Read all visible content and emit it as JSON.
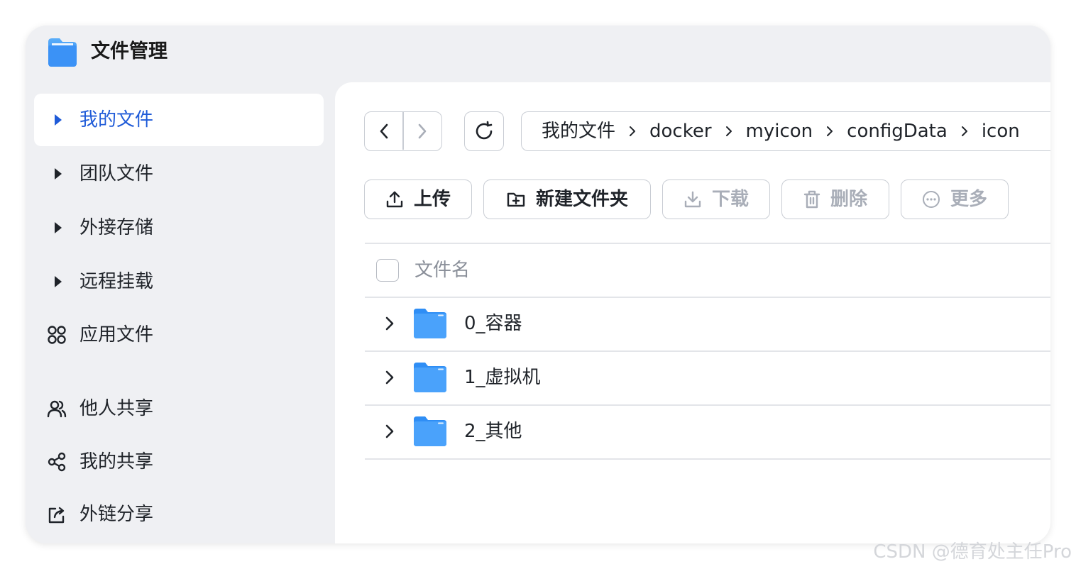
{
  "app": {
    "title": "文件管理",
    "icon": "files-app-icon"
  },
  "sidebar": {
    "items": [
      {
        "label": "我的文件",
        "icon": "caret-right-icon",
        "active": true
      },
      {
        "label": "团队文件",
        "icon": "caret-right-icon",
        "active": false
      },
      {
        "label": "外接存储",
        "icon": "caret-right-icon",
        "active": false
      },
      {
        "label": "远程挂载",
        "icon": "caret-right-icon",
        "active": false
      },
      {
        "label": "应用文件",
        "icon": "apps-grid-icon",
        "active": false
      },
      {
        "label": "他人共享",
        "icon": "users-icon",
        "active": false
      },
      {
        "label": "我的共享",
        "icon": "share-icon",
        "active": false
      },
      {
        "label": "外链分享",
        "icon": "external-link-icon",
        "active": false
      }
    ]
  },
  "breadcrumb": [
    "我的文件",
    "docker",
    "myicon",
    "configData",
    "icon"
  ],
  "toolbar": {
    "upload": "上传",
    "new_folder": "新建文件夹",
    "download": "下载",
    "delete": "删除",
    "more": "更多"
  },
  "table": {
    "header": "文件名",
    "rows": [
      {
        "name": "0_容器",
        "type": "folder"
      },
      {
        "name": "1_虚拟机",
        "type": "folder"
      },
      {
        "name": "2_其他",
        "type": "folder"
      }
    ]
  },
  "colors": {
    "accent": "#1f5bd8",
    "folder": "#2f8ef5",
    "disabled": "#a9aeb8",
    "sidebar_bg": "#eff0f3"
  },
  "watermark": "CSDN @德育处主任Pro"
}
